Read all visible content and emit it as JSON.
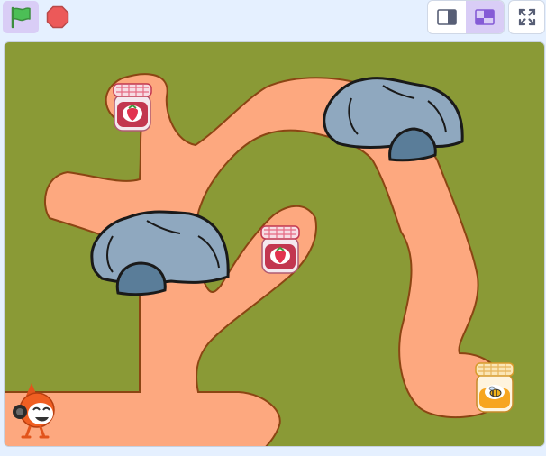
{
  "toolbar": {
    "green_flag": {
      "icon": "green-flag-icon",
      "color": "#4cbf56"
    },
    "stop": {
      "icon": "stop-sign-icon",
      "color": "#ec5959"
    },
    "layout": {
      "small_stage": {
        "icon": "small-stage-layout-icon",
        "selected": false
      },
      "normal_stage": {
        "icon": "normal-stage-layout-icon",
        "selected": true
      }
    },
    "fullscreen": {
      "icon": "fullscreen-icon"
    }
  },
  "stage": {
    "background_color": "#8a9a36",
    "path_color": "#fda87f",
    "sprites": [
      {
        "name": "strawberry-jam-jar",
        "icon": "strawberry-jam-icon"
      },
      {
        "name": "strawberry-jam-jar",
        "icon": "strawberry-jam-icon"
      },
      {
        "name": "honey-jar",
        "icon": "honey-jar-icon"
      },
      {
        "name": "rock",
        "icon": "rock-icon"
      },
      {
        "name": "rock",
        "icon": "rock-icon"
      },
      {
        "name": "pico-character",
        "icon": "pico-character-icon"
      }
    ]
  }
}
